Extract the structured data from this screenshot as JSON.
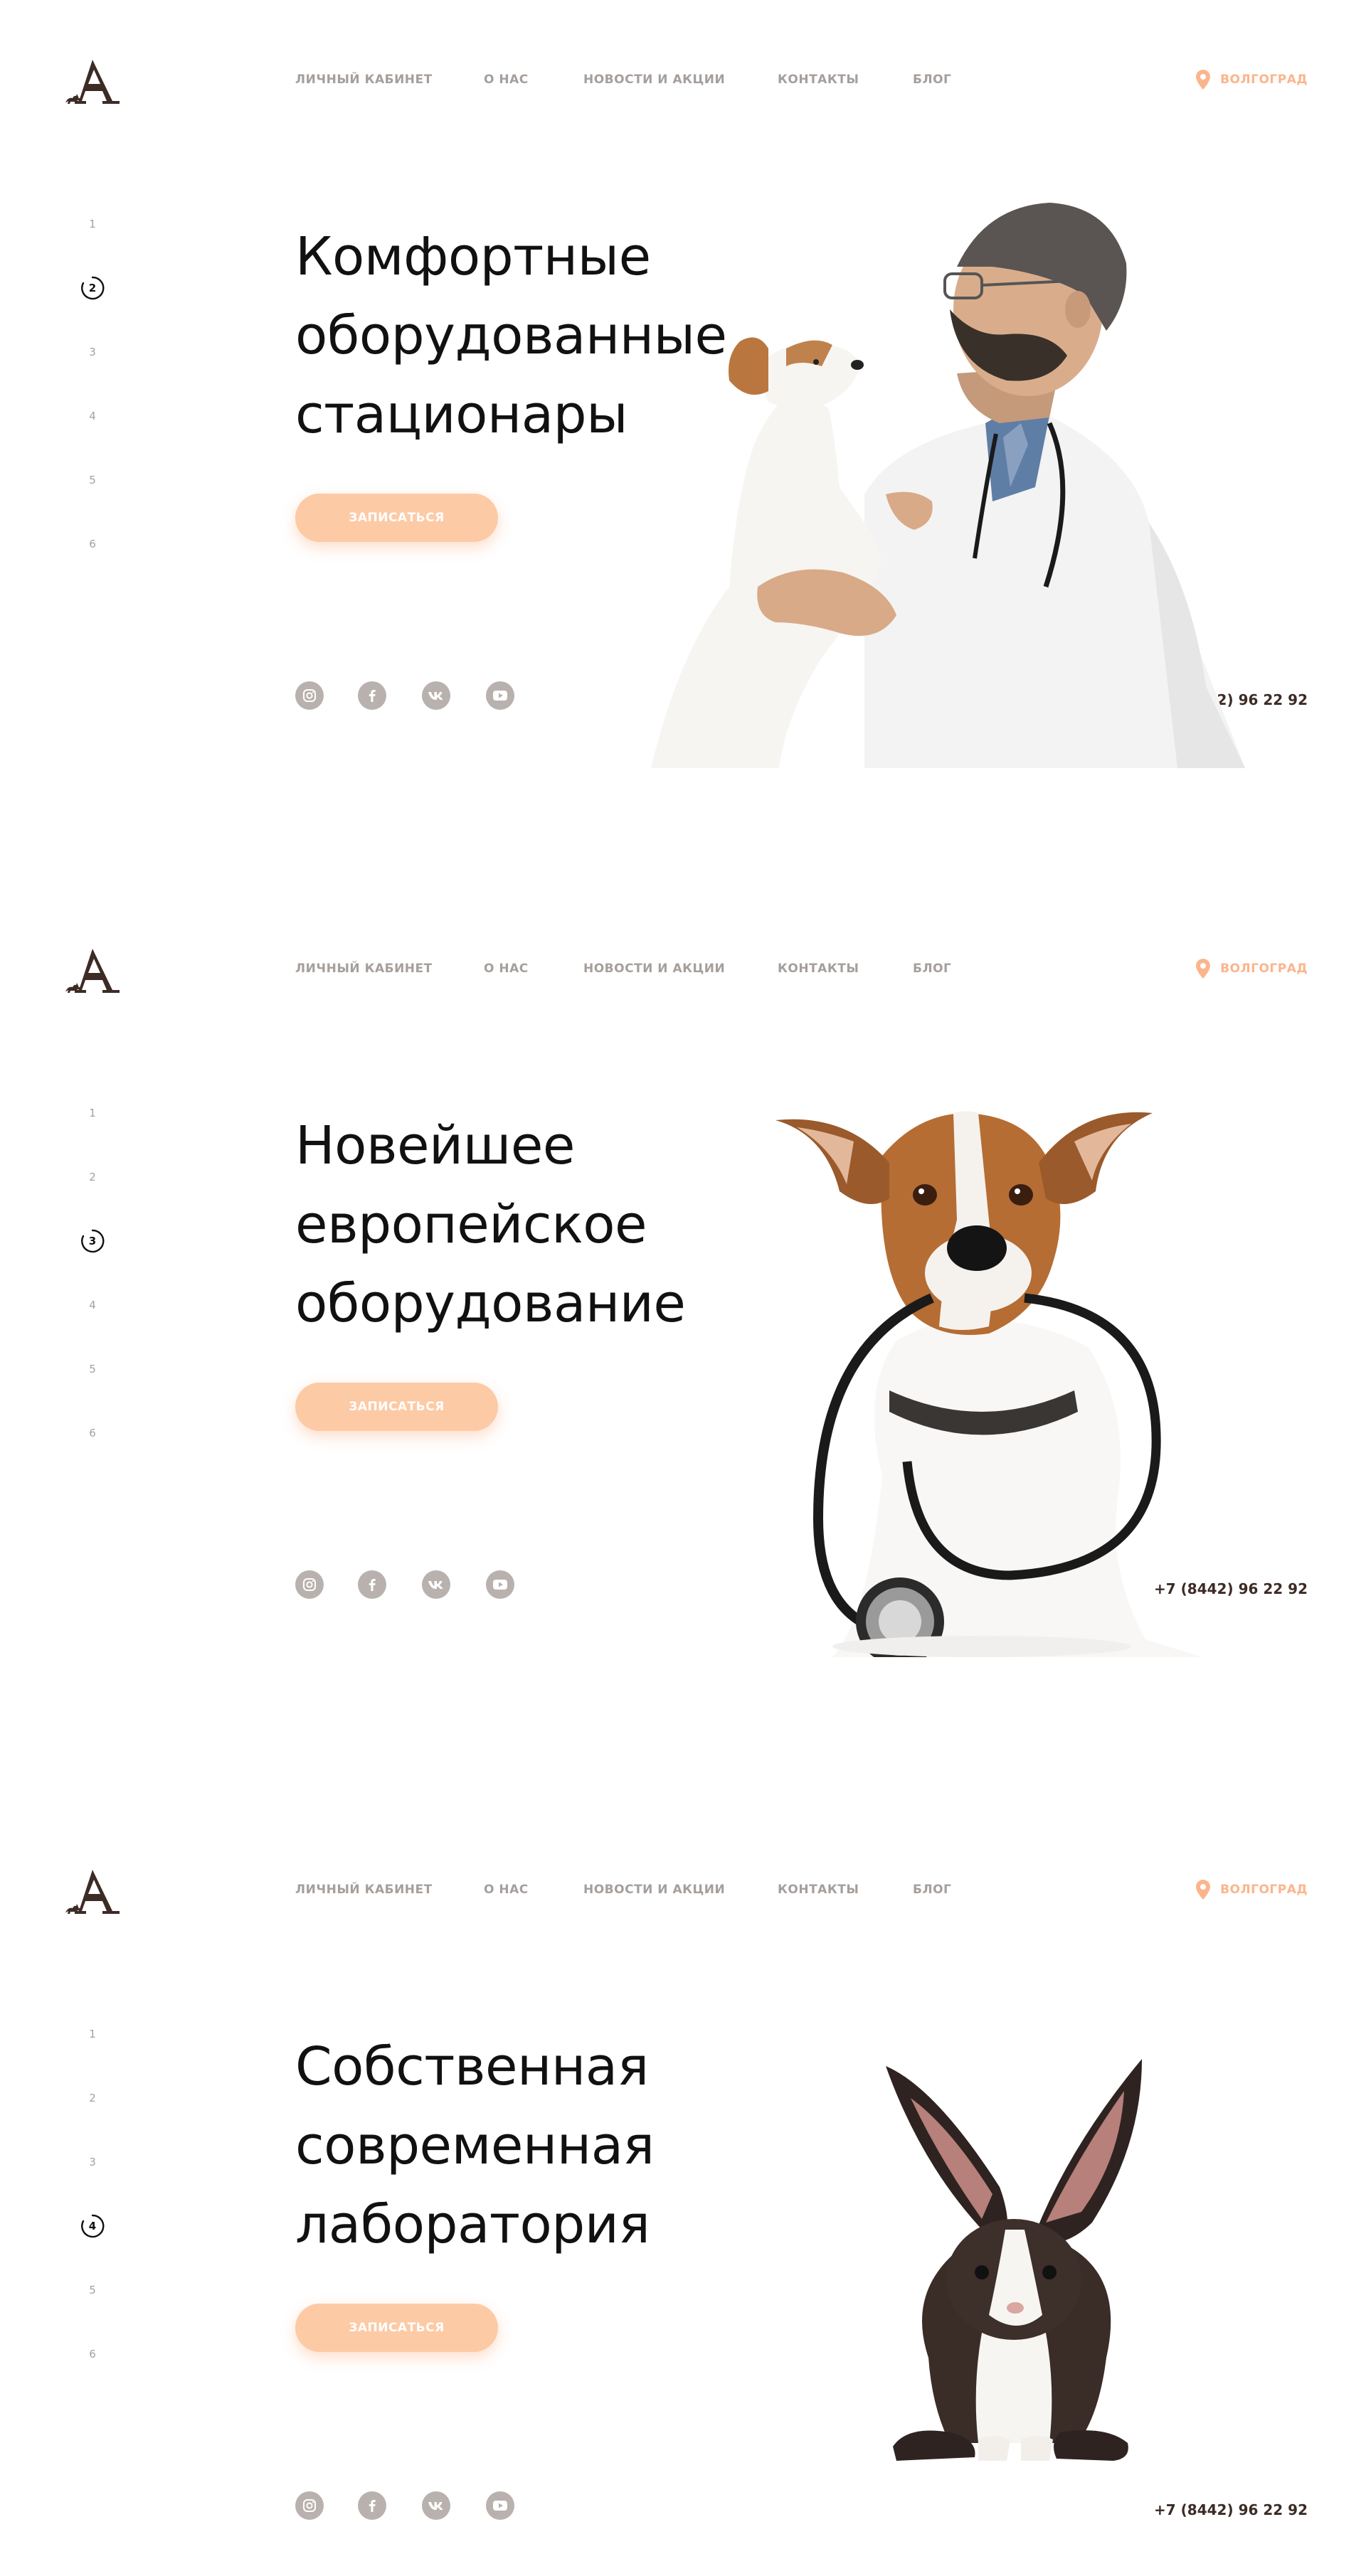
{
  "colors": {
    "accent": "#fbb58c",
    "button_bg": "#fdcaa6",
    "nav_text": "#a59f9c",
    "brand_brown": "#3d2b26",
    "social_bg": "#b8b1ad"
  },
  "header": {
    "logo_letter": "A",
    "nav": [
      "ЛИЧНЫЙ КАБИНЕТ",
      "О НАС",
      "НОВОСТИ И АКЦИИ",
      "КОНТАКТЫ",
      "БЛОГ"
    ],
    "city": "ВОЛГОГРАД"
  },
  "pager_numbers": [
    "1",
    "2",
    "3",
    "4",
    "5",
    "6"
  ],
  "cta_label": "ЗАПИСАТЬСЯ",
  "phone": "+7 (8442) 96 22 92",
  "icons": {
    "logo": "logo-icon",
    "city": "map-pin-icon",
    "socials": [
      "instagram-icon",
      "facebook-icon",
      "vk-icon",
      "youtube-icon"
    ],
    "pager_active": "ring-icon"
  },
  "slides": [
    {
      "active_page": "2",
      "title_lines": [
        "Комфортные",
        "оборудованные",
        "стационары"
      ],
      "image": "doctor-kissing-dog"
    },
    {
      "active_page": "3",
      "title_lines": [
        "Новейшее",
        "европейское",
        "оборудование"
      ],
      "image": "dog-with-stethoscope"
    },
    {
      "active_page": "4",
      "title_lines": [
        "Собственная",
        "современная",
        "лаборатория"
      ],
      "image": "rabbit"
    }
  ]
}
